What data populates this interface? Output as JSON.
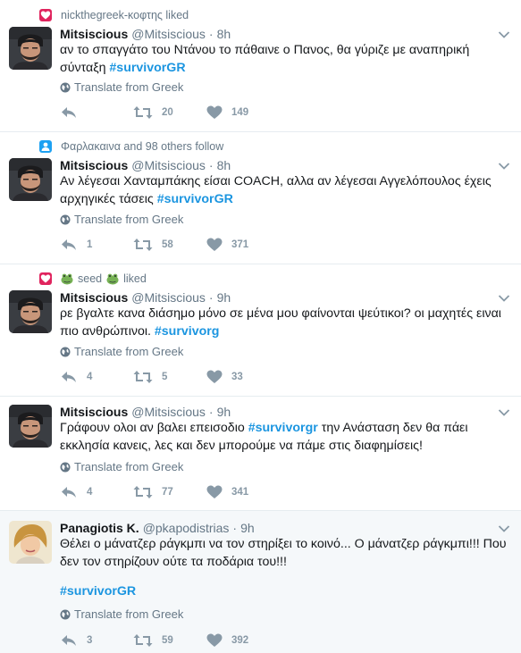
{
  "colors": {
    "accent": "#1b95e0",
    "like_context": "#e0245e",
    "follow_context": "#1da1f2",
    "muted": "#657786",
    "action_icon": "#8899a6",
    "highlight_bg": "#f5f8fa"
  },
  "tweets": [
    {
      "context": {
        "icon": "heart-icon",
        "text": "nickthegreek-κοφτης liked"
      },
      "name": "Mitsiscious",
      "handle": "@Mitsiscious",
      "dot": "·",
      "time": "8h",
      "text_plain": "αν το σπαγγάτο του Ντάνου το πάθαινε ο Πανος, θα γύριζε με αναπηρική σύνταξη",
      "hashtag": "#survivorGR",
      "translate": "Translate from Greek",
      "replies": "",
      "retweets": "20",
      "likes": "149"
    },
    {
      "context": {
        "icon": "person-icon",
        "text": "Φαρλακαινα and 98 others follow"
      },
      "name": "Mitsiscious",
      "handle": "@Mitsiscious",
      "dot": "·",
      "time": "8h",
      "text_plain": "Αν λέγεσαι Χανταμπάκης είσαι COACH, αλλα αν λέγεσαι Αγγελόπουλος έχεις αρχηγικές τάσεις",
      "hashtag": "#survivorGR",
      "translate": "Translate from Greek",
      "replies": "1",
      "retweets": "58",
      "likes": "371"
    },
    {
      "context": {
        "icon": "heart-icon",
        "text_before": "seed",
        "text_after": "liked"
      },
      "name": "Mitsiscious",
      "handle": "@Mitsiscious",
      "dot": "·",
      "time": "9h",
      "text_plain": "ρε βγαλτε κανα διάσημο μόνο σε μένα μου φαίνονται ψεύτικοι? οι μαχητές ειναι πιο ανθρώπινοι.",
      "hashtag": "#survivorg",
      "translate": "Translate from Greek",
      "replies": "4",
      "retweets": "5",
      "likes": "33"
    },
    {
      "name": "Mitsiscious",
      "handle": "@Mitsiscious",
      "dot": "·",
      "time": "9h",
      "text_before": "Γράφουν ολοι αν βαλει επεισοδιο",
      "hashtag": "#survivorgr",
      "text_after": "την Ανάσταση δεν θα πάει εκκλησία  κανεις, λες και δεν μπορούμε να πάμε στις διαφημίσεις!",
      "translate": "Translate from Greek",
      "replies": "4",
      "retweets": "77",
      "likes": "341"
    },
    {
      "name": "Panagiotis K.",
      "handle": "@pkapodistrias",
      "dot": "·",
      "time": "9h",
      "text_plain": "Θέλει ο μάνατζερ ράγκμπι να τον στηρίξει το κοινό... Ο μάνατζερ ράγκμπι!!! Που δεν τον στηρίζουν ούτε τα ποδάρια του!!!",
      "hashtag": "#survivorGR",
      "translate": "Translate from Greek",
      "replies": "3",
      "retweets": "59",
      "likes": "392"
    }
  ]
}
